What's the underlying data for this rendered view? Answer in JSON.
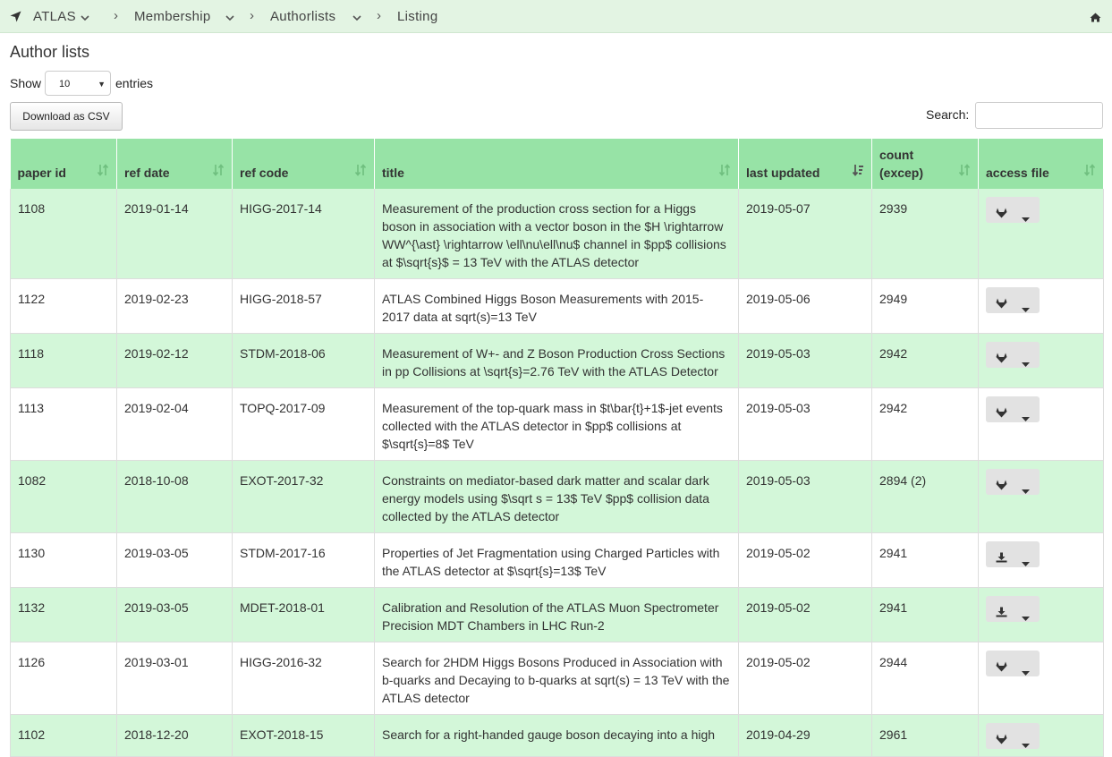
{
  "breadcrumb": {
    "items": [
      {
        "label": "ATLAS"
      },
      {
        "label": "Membership"
      },
      {
        "label": "Authorlists"
      },
      {
        "label": "Listing"
      }
    ],
    "icons": {
      "nav": "location-arrow-icon",
      "home": "home-icon"
    }
  },
  "page": {
    "title": "Author lists"
  },
  "controls": {
    "show_label": "Show",
    "entries_value": "10",
    "entries_label": "entries",
    "csv_label": "Download as CSV",
    "search_label": "Search:",
    "search_value": ""
  },
  "table": {
    "headers": {
      "paper_id": "paper id",
      "ref_date": "ref date",
      "ref_code": "ref code",
      "title": "title",
      "last_updated": "last updated",
      "count_l1": "count",
      "count_l2": "(excep)",
      "access": "access file"
    },
    "sorted_column": "last updated",
    "rows": [
      {
        "id": "1108",
        "date": "2019-01-14",
        "code": "HIGG-2017-14",
        "title": "Measurement of the production cross section for a Higgs boson in association with a vector boson in the $H \\rightarrow WW^{\\ast} \\rightarrow \\ell\\nu\\ell\\nu$ channel in $pp$ collisions at $\\sqrt{s}$ = 13 TeV with the ATLAS detector",
        "updated": "2019-05-07",
        "count": "2939",
        "access_icon": "gitlab-icon"
      },
      {
        "id": "1122",
        "date": "2019-02-23",
        "code": "HIGG-2018-57",
        "title": "ATLAS Combined Higgs Boson Measurements with 2015-2017 data at sqrt(s)=13 TeV",
        "updated": "2019-05-06",
        "count": "2949",
        "access_icon": "gitlab-icon"
      },
      {
        "id": "1118",
        "date": "2019-02-12",
        "code": "STDM-2018-06",
        "title": "Measurement of W+- and Z Boson Production Cross Sections in pp Collisions at \\sqrt{s}=2.76 TeV with the ATLAS Detector",
        "updated": "2019-05-03",
        "count": "2942",
        "access_icon": "gitlab-icon"
      },
      {
        "id": "1113",
        "date": "2019-02-04",
        "code": "TOPQ-2017-09",
        "title": "Measurement of the top-quark mass in $t\\bar{t}+1$-jet events collected with the ATLAS detector in $pp$ collisions at $\\sqrt{s}=8$ TeV",
        "updated": "2019-05-03",
        "count": "2942",
        "access_icon": "gitlab-icon"
      },
      {
        "id": "1082",
        "date": "2018-10-08",
        "code": "EXOT-2017-32",
        "title": "Constraints on mediator-based dark matter and scalar dark energy models using $\\sqrt s = 13$ TeV $pp$ collision data collected by the ATLAS detector",
        "updated": "2019-05-03",
        "count": "2894 (2)",
        "access_icon": "gitlab-icon"
      },
      {
        "id": "1130",
        "date": "2019-03-05",
        "code": "STDM-2017-16",
        "title": "Properties of Jet Fragmentation using Charged Particles with the ATLAS detector at $\\sqrt{s}=13$ TeV",
        "updated": "2019-05-02",
        "count": "2941",
        "access_icon": "download-icon"
      },
      {
        "id": "1132",
        "date": "2019-03-05",
        "code": "MDET-2018-01",
        "title": "Calibration and Resolution of the ATLAS Muon Spectrometer Precision MDT Chambers in LHC Run-2",
        "updated": "2019-05-02",
        "count": "2941",
        "access_icon": "download-icon"
      },
      {
        "id": "1126",
        "date": "2019-03-01",
        "code": "HIGG-2016-32",
        "title": "Search for 2HDM Higgs Bosons Produced in Association with b-quarks and Decaying to b-quarks at sqrt(s) = 13 TeV with the ATLAS detector",
        "updated": "2019-05-02",
        "count": "2944",
        "access_icon": "gitlab-icon"
      },
      {
        "id": "1102",
        "date": "2018-12-20",
        "code": "EXOT-2018-15",
        "title": "Search for a right-handed gauge boson decaying into a high",
        "updated": "2019-04-29",
        "count": "2961",
        "access_icon": "gitlab-icon"
      }
    ]
  }
}
